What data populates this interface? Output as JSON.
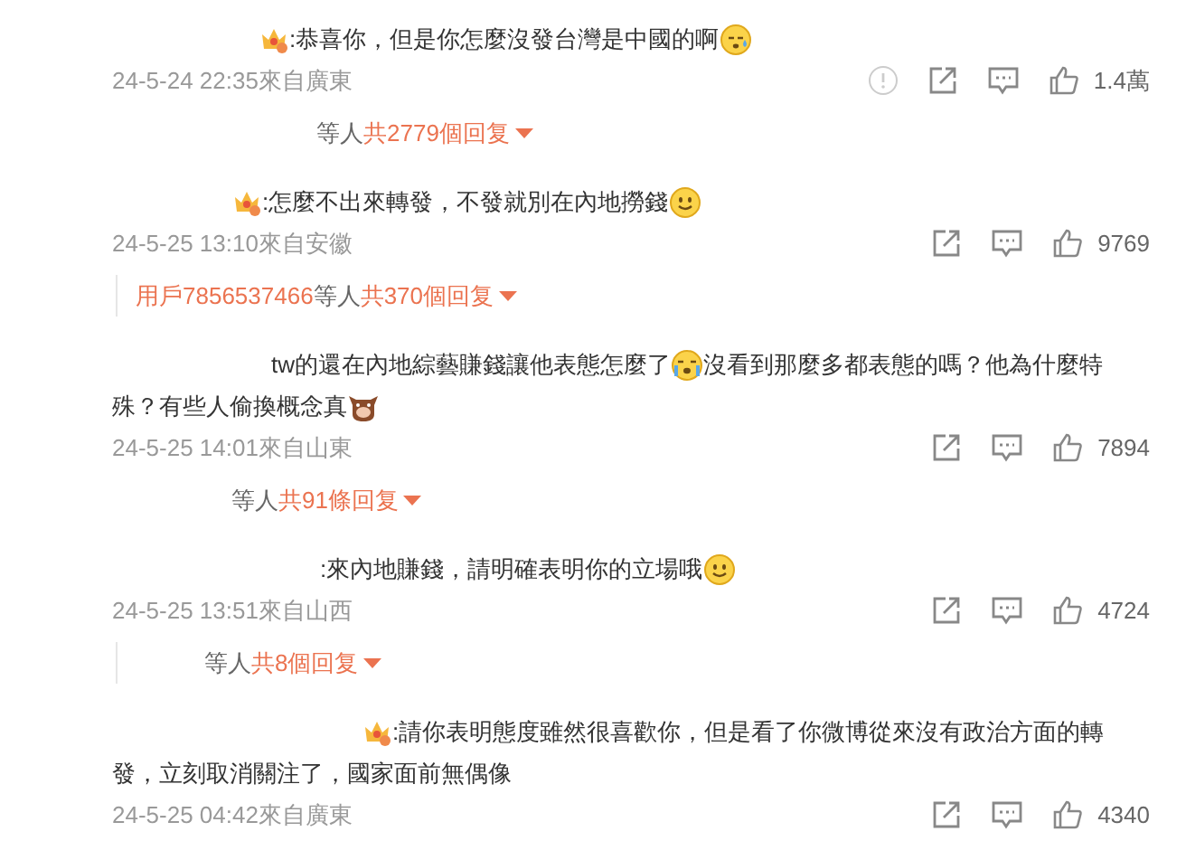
{
  "comments": [
    {
      "badge": true,
      "lines": [
        [
          {
            "kind": "text",
            "text": ":恭喜你，但是你怎麼沒發台灣是中國的啊"
          },
          {
            "kind": "sweat"
          }
        ]
      ],
      "time": "24-5-24 22:35來自廣東",
      "report": true,
      "likes": "1.4萬",
      "replies": {
        "others": "等人",
        "count": "共2779個回复"
      }
    },
    {
      "badge": true,
      "lines": [
        [
          {
            "kind": "text",
            "text": ":怎麼不出來轉發，不發就別在內地撈錢"
          },
          {
            "kind": "smile"
          }
        ]
      ],
      "time": "24-5-25 13:10來自安徽",
      "report": false,
      "likes": "9769",
      "replies": {
        "user": "用戶7856537466",
        "others": "等人",
        "count": "共370個回复"
      }
    },
    {
      "badge": false,
      "lines": [
        [
          {
            "kind": "text",
            "text": "tw的還在內地綜藝賺錢讓他表態怎麼了"
          },
          {
            "kind": "cry"
          },
          {
            "kind": "text",
            "text": "沒看到那麼多都表態的嗎？他為什麼特"
          }
        ],
        [
          {
            "kind": "text",
            "text": "殊？有些人偷換概念真"
          },
          {
            "kind": "cow"
          }
        ]
      ],
      "time": "24-5-25 14:01來自山東",
      "report": false,
      "likes": "7894",
      "replies": {
        "others": "等人",
        "count": "共91條回复"
      }
    },
    {
      "badge": false,
      "lines": [
        [
          {
            "kind": "text",
            "text": ":來內地賺錢，請明確表明你的立場哦"
          },
          {
            "kind": "smile"
          }
        ]
      ],
      "time": "24-5-25 13:51來自山西",
      "report": false,
      "likes": "4724",
      "replies": {
        "others": "等人",
        "count": "共8個回复"
      }
    },
    {
      "badge": true,
      "lines": [
        [
          {
            "kind": "text",
            "text": ":請你表明態度雖然很喜歡你，但是看了你微博從來沒有政治方面的轉"
          }
        ],
        [
          {
            "kind": "text",
            "text": "發，立刻取消關注了，國家面前無偶像"
          }
        ]
      ],
      "time": "24-5-25 04:42來自廣東",
      "report": false,
      "likes": "4340"
    }
  ]
}
